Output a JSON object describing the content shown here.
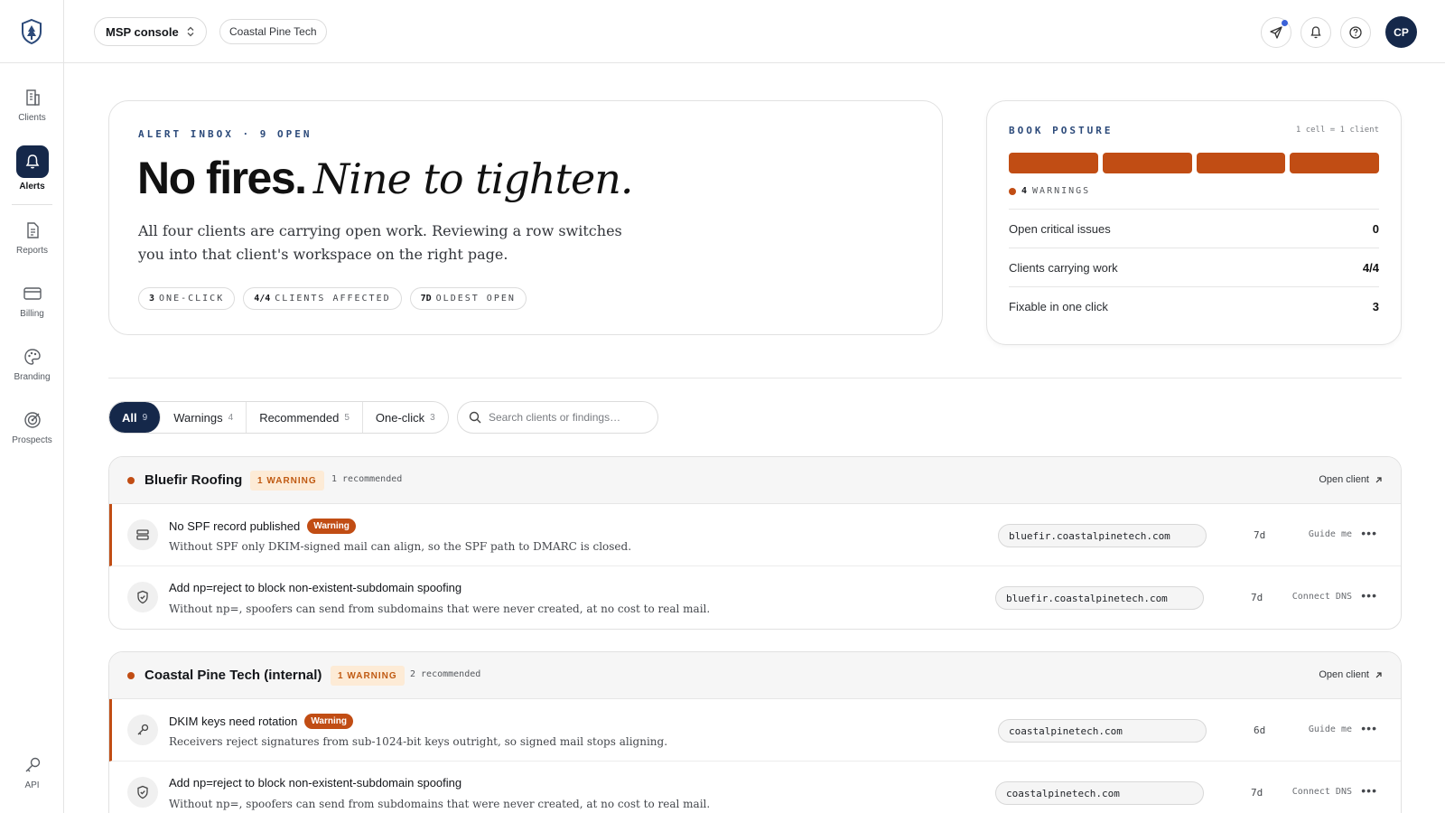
{
  "header": {
    "console_label": "MSP console",
    "tenant": "Coastal Pine Tech",
    "avatar_initials": "CP"
  },
  "nav": {
    "items": [
      {
        "label": "Clients",
        "icon": "building-icon"
      },
      {
        "label": "Alerts",
        "icon": "bell-icon"
      },
      {
        "label": "Reports",
        "icon": "document-icon"
      },
      {
        "label": "Billing",
        "icon": "card-icon"
      },
      {
        "label": "Branding",
        "icon": "palette-icon"
      },
      {
        "label": "Prospects",
        "icon": "target-icon"
      },
      {
        "label": "API",
        "icon": "key-icon"
      }
    ],
    "active": "Alerts"
  },
  "hero": {
    "eyebrow": "ALERT INBOX · 9 OPEN",
    "headline_bold": "No fires.",
    "headline_italic": "Nine to tighten.",
    "description": "All four clients are carrying open work. Reviewing a row switches you into that client's workspace on the right page.",
    "pills": [
      {
        "value": "3",
        "label": "ONE-CLICK"
      },
      {
        "value": "4/4",
        "label": "CLIENTS AFFECTED"
      },
      {
        "value": "7D",
        "label": "OLDEST OPEN"
      }
    ]
  },
  "posture": {
    "title": "BOOK POSTURE",
    "legend": "1 cell = 1 client",
    "cells": 4,
    "warning_count": "4",
    "warning_label": "WARNINGS",
    "stats": [
      {
        "label": "Open critical issues",
        "value": "0"
      },
      {
        "label": "Clients carrying work",
        "value": "4/4"
      },
      {
        "label": "Fixable in one click",
        "value": "3"
      }
    ]
  },
  "filters": {
    "tabs": [
      {
        "label": "All",
        "count": "9"
      },
      {
        "label": "Warnings",
        "count": "4"
      },
      {
        "label": "Recommended",
        "count": "5"
      },
      {
        "label": "One-click",
        "count": "3"
      }
    ],
    "active": "All",
    "search_placeholder": "Search clients or findings…"
  },
  "groups": [
    {
      "name": "Bluefir Roofing",
      "badge": "1 WARNING",
      "recommended": "1 recommended",
      "open_label": "Open client",
      "rows": [
        {
          "title": "No SPF record published",
          "tag": "Warning",
          "desc": "Without SPF only DKIM-signed mail can align, so the SPF path to DMARC is closed.",
          "domain": "bluefir.coastalpinetech.com",
          "age": "7d",
          "action": "Guide me",
          "icon": "server-icon"
        },
        {
          "title": "Add np=reject to block non-existent-subdomain spoofing",
          "tag": "",
          "desc": "Without np=, spoofers can send from subdomains that were never created, at no cost to real mail.",
          "domain": "bluefir.coastalpinetech.com",
          "age": "7d",
          "action": "Connect DNS",
          "icon": "shield-check-icon"
        }
      ]
    },
    {
      "name": "Coastal Pine Tech (internal)",
      "badge": "1 WARNING",
      "recommended": "2 recommended",
      "open_label": "Open client",
      "rows": [
        {
          "title": "DKIM keys need rotation",
          "tag": "Warning",
          "desc": "Receivers reject signatures from sub-1024-bit keys outright, so signed mail stops aligning.",
          "domain": "coastalpinetech.com",
          "age": "6d",
          "action": "Guide me",
          "icon": "key-icon"
        },
        {
          "title": "Add np=reject to block non-existent-subdomain spoofing",
          "tag": "",
          "desc": "Without np=, spoofers can send from subdomains that were never created, at no cost to real mail.",
          "domain": "coastalpinetech.com",
          "age": "7d",
          "action": "Connect DNS",
          "icon": "shield-check-icon"
        }
      ]
    }
  ],
  "colors": {
    "accent": "#15284a",
    "warning": "#c14d14",
    "warning_bg": "#fdebd6",
    "notification_dot": "#3b62d8"
  }
}
